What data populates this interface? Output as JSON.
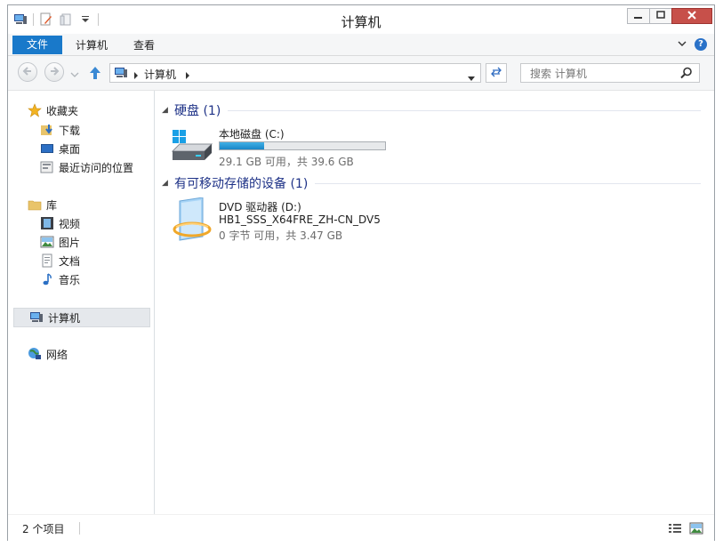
{
  "window": {
    "title": "计算机",
    "controls": [
      "minimize-icon",
      "restore-icon",
      "close-icon"
    ]
  },
  "ribbon": {
    "tabs": [
      {
        "label": "文件",
        "active": true
      },
      {
        "label": "计算机"
      },
      {
        "label": "查看"
      }
    ],
    "help_label": "?"
  },
  "address": {
    "crumbs": [
      "计算机"
    ],
    "search_placeholder": "搜索 计算机"
  },
  "navpane": {
    "favorites": {
      "label": "收藏夹",
      "items": [
        "下载",
        "桌面",
        "最近访问的位置"
      ]
    },
    "libraries": {
      "label": "库",
      "items": [
        "视频",
        "图片",
        "文档",
        "音乐"
      ]
    },
    "computer": {
      "label": "计算机",
      "selected": true
    },
    "network": {
      "label": "网络"
    }
  },
  "content": {
    "groups": [
      {
        "title": "硬盘 (1)",
        "drives": [
          {
            "name": "本地磁盘 (C:)",
            "detail": "29.1 GB 可用，共 39.6 GB",
            "used_fraction": 0.27
          }
        ]
      },
      {
        "title": "有可移动存储的设备 (1)",
        "drives": [
          {
            "name": "DVD 驱动器 (D:)",
            "label": "HB1_SSS_X64FRE_ZH-CN_DV5",
            "detail": "0 字节 可用，共 3.47 GB"
          }
        ]
      }
    ]
  },
  "status": {
    "item_count": "2 个项目"
  },
  "colors": {
    "accent": "#1979ca",
    "group_header": "#1e3287",
    "close_button": "#c7504a",
    "usage_bar": "#26a0da"
  }
}
